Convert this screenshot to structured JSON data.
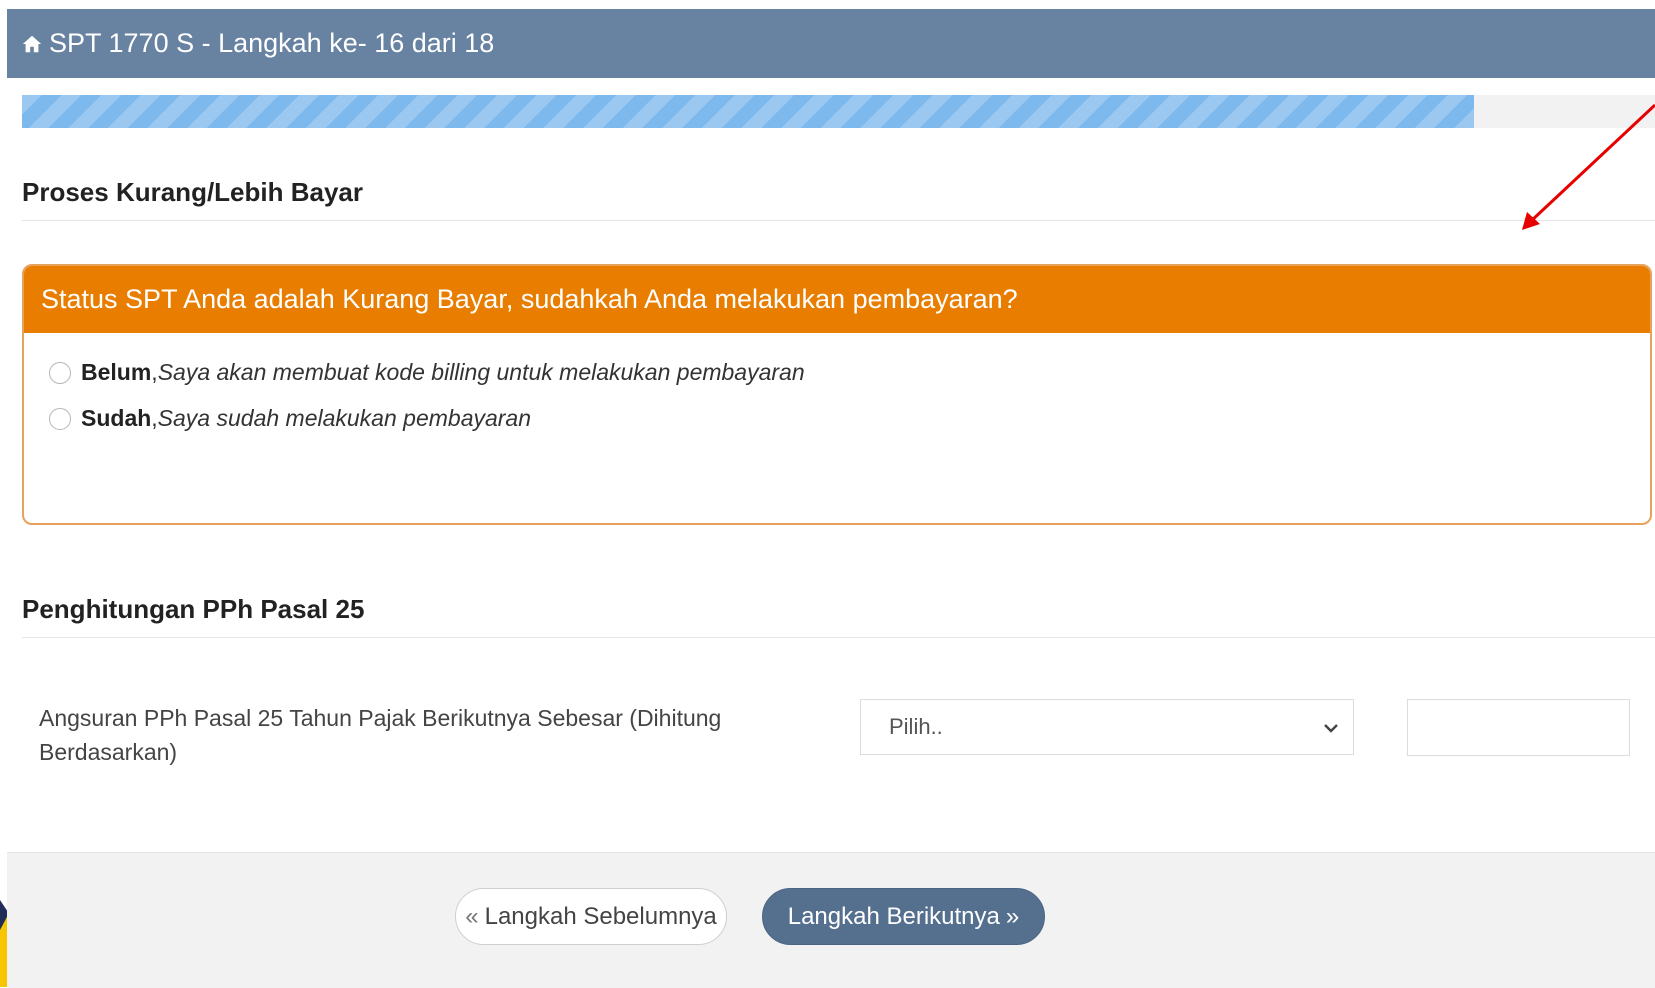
{
  "header": {
    "icon": "home-icon",
    "title": "SPT 1770 S - Langkah ke- 16 dari 18"
  },
  "progress": {
    "percent": 88.9
  },
  "section_kurang_lebih": {
    "title": "Proses Kurang/Lebih Bayar"
  },
  "status_panel": {
    "heading": "Status SPT Anda adalah Kurang Bayar, sudahkah Anda melakukan pembayaran?",
    "options": [
      {
        "label": "Belum",
        "separator": ", ",
        "description": "Saya akan membuat kode billing untuk melakukan pembayaran"
      },
      {
        "label": "Sudah",
        "separator": ", ",
        "description": "Saya sudah melakukan pembayaran"
      }
    ]
  },
  "section_pph25": {
    "title": "Penghitungan PPh Pasal 25",
    "field_label": "Angsuran PPh Pasal 25 Tahun Pajak Berikutnya Sebesar (Dihitung Berdasarkan)",
    "select_value": "Pilih..",
    "amount_value": ""
  },
  "footer": {
    "prev_glyph": "«",
    "prev_label": "Langkah Sebelumnya",
    "next_label": "Langkah Berikutnya",
    "next_glyph": "»"
  },
  "colors": {
    "header_bg": "#6882a2",
    "progress_fill": "#7db9ec",
    "panel_heading_bg": "#e87d00",
    "panel_border": "#e8a25b",
    "next_button_bg": "#556f8f",
    "annotation_arrow": "#e60000",
    "background_dark": "#1f2d57",
    "background_yellow": "#f7c600"
  }
}
